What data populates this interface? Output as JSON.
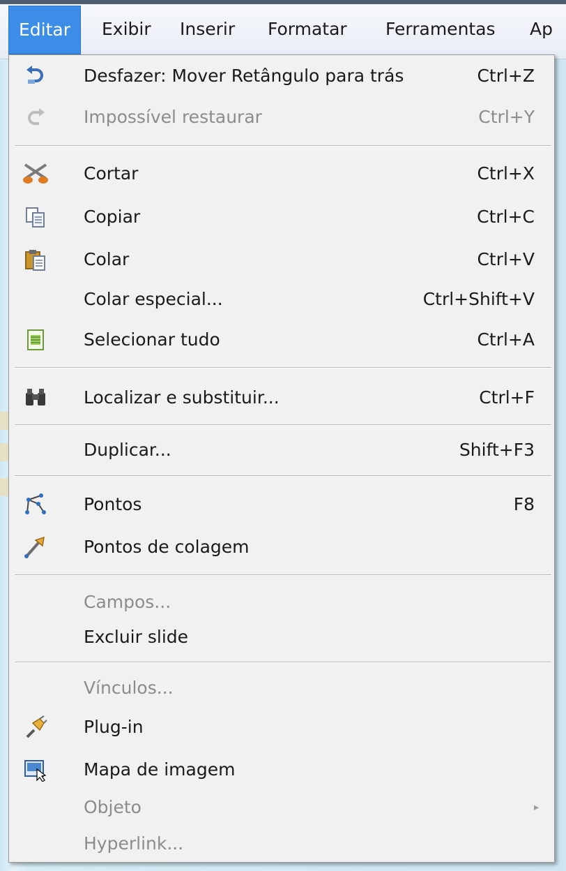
{
  "menubar": {
    "items": [
      {
        "label": "Editar",
        "accel": "E",
        "active": true
      },
      {
        "label": "Exibir",
        "accel": "x"
      },
      {
        "label": "Inserir",
        "accel": "I"
      },
      {
        "label": "Formatar",
        "accel": "F"
      },
      {
        "label": "Ferramentas",
        "accel": "r"
      },
      {
        "label": "Ap"
      }
    ]
  },
  "menu": {
    "items": [
      {
        "label": "Desfazer: Mover Retângulo para trás",
        "shortcut": "Ctrl+Z",
        "icon": "undo-icon",
        "enabled": true
      },
      {
        "label": "Impossível restaurar",
        "shortcut": "Ctrl+Y",
        "icon": "redo-icon",
        "enabled": false
      },
      {
        "label": "Cortar",
        "shortcut": "Ctrl+X",
        "icon": "scissors-icon",
        "enabled": true
      },
      {
        "label": "Copiar",
        "shortcut": "Ctrl+C",
        "icon": "copy-icon",
        "enabled": true
      },
      {
        "label": "Colar",
        "shortcut": "Ctrl+V",
        "icon": "paste-icon",
        "enabled": true
      },
      {
        "label": "Colar especial...",
        "shortcut": "Ctrl+Shift+V",
        "icon": "",
        "enabled": true
      },
      {
        "label": "Selecionar tudo",
        "shortcut": "Ctrl+A",
        "icon": "select-all-icon",
        "enabled": true
      },
      {
        "label": "Localizar e substituir...",
        "shortcut": "Ctrl+F",
        "icon": "binoculars-icon",
        "enabled": true
      },
      {
        "label": "Duplicar...",
        "shortcut": "Shift+F3",
        "icon": "",
        "enabled": true
      },
      {
        "label": "Pontos",
        "shortcut": "F8",
        "icon": "points-icon",
        "enabled": true
      },
      {
        "label": "Pontos de colagem",
        "shortcut": "",
        "icon": "glue-points-icon",
        "enabled": true
      },
      {
        "label": "Campos...",
        "shortcut": "",
        "icon": "",
        "enabled": false
      },
      {
        "label": "Excluir slide",
        "shortcut": "",
        "icon": "",
        "enabled": true
      },
      {
        "label": "Vínculos...",
        "shortcut": "",
        "icon": "",
        "enabled": false
      },
      {
        "label": "Plug-in",
        "shortcut": "",
        "icon": "plugin-icon",
        "enabled": true
      },
      {
        "label": "Mapa de imagem",
        "shortcut": "",
        "icon": "image-map-icon",
        "enabled": true
      },
      {
        "label": "Objeto",
        "shortcut": "",
        "icon": "",
        "enabled": false,
        "submenu": true,
        "submenu_glyph": "▸"
      },
      {
        "label": "Hyperlink...",
        "shortcut": "",
        "icon": "",
        "enabled": false
      }
    ]
  }
}
